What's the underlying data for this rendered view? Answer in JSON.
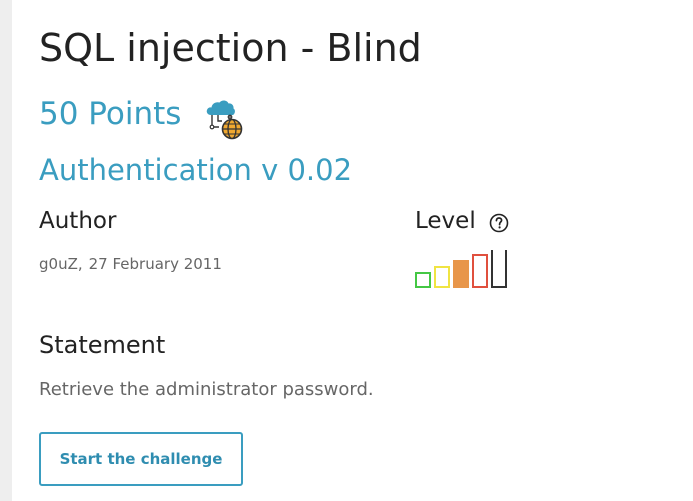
{
  "challenge": {
    "title": "SQL injection - Blind",
    "points": "50 Points",
    "category_icon": "cloud-network-globe-icon",
    "subtitle": "Authentication v 0.02"
  },
  "author": {
    "label": "Author",
    "name": "g0uZ,",
    "date": "27 February 2011"
  },
  "level": {
    "label": "Level",
    "help_icon": "question-circle-icon",
    "current": 3,
    "max": 5,
    "colors": [
      "#44c744",
      "#f0e442",
      "#e8964a",
      "#e0503e",
      "#333333"
    ]
  },
  "statement": {
    "label": "Statement",
    "text": "Retrieve the administrator password."
  },
  "actions": {
    "start_label": "Start the challenge"
  },
  "colors": {
    "accent": "#3a9dc0",
    "text_dark": "#222222",
    "text_muted": "#666666"
  }
}
